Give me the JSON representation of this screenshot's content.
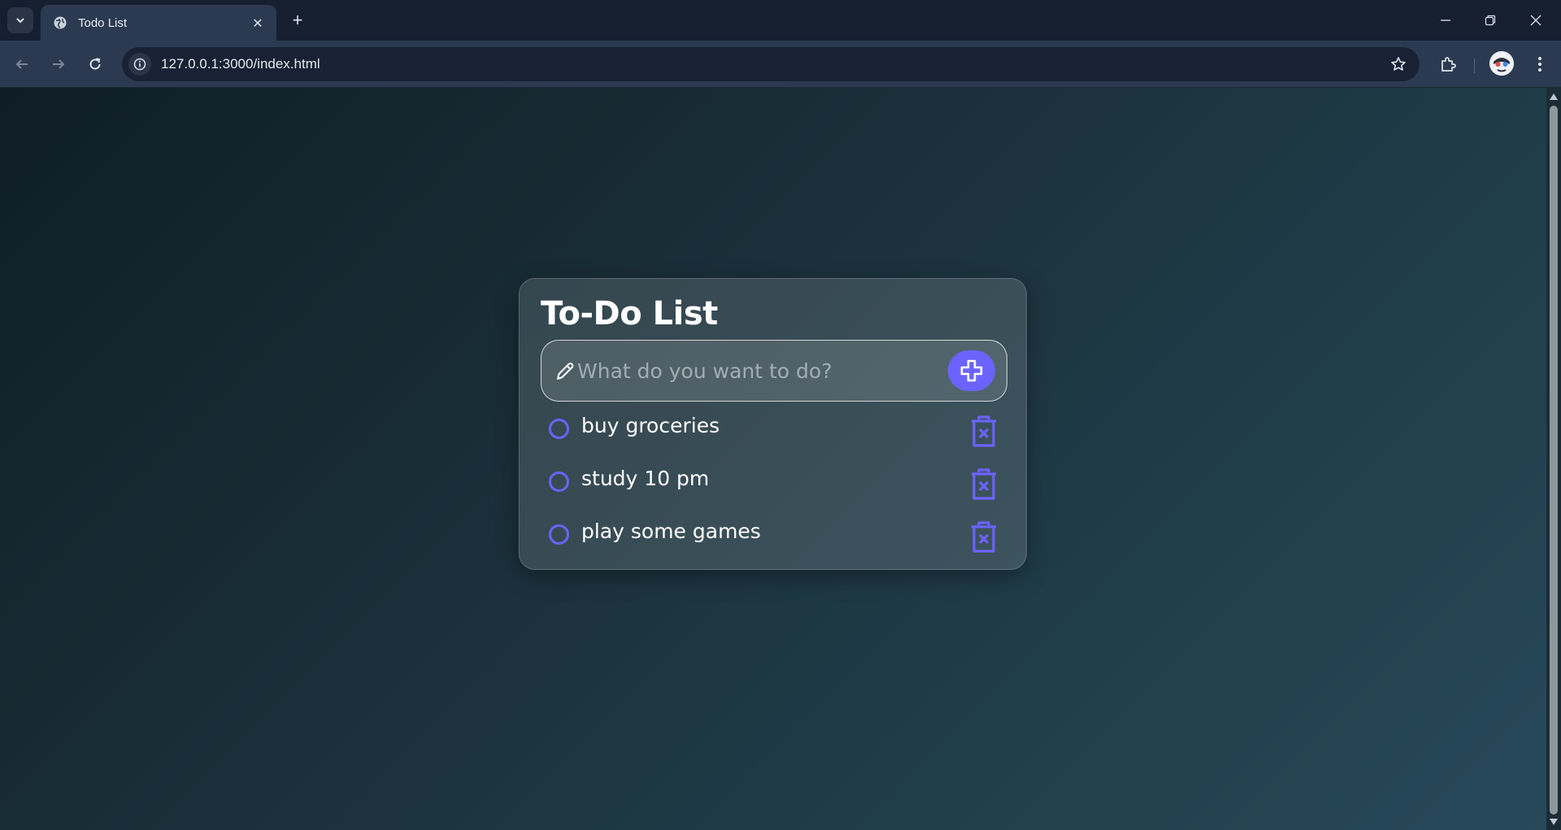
{
  "browser": {
    "tab_title": "Todo List",
    "tab_close_glyph": "✕",
    "new_tab_glyph": "+",
    "url": "127.0.0.1:3000/index.html",
    "icons": [
      "tab-search-icon",
      "globe-icon",
      "back-icon",
      "forward-icon",
      "reload-icon",
      "site-info-icon",
      "bookmark-star-icon",
      "extensions-icon",
      "profile-avatar",
      "menu-kebab-icon",
      "minimize-icon",
      "restore-icon",
      "close-icon"
    ]
  },
  "app": {
    "title": "To-Do List",
    "input_placeholder": "What do you want to do?",
    "input_value": "",
    "accent_color": "#6c63ff",
    "todos": [
      {
        "text": "buy groceries",
        "done": false
      },
      {
        "text": "study 10 pm",
        "done": false
      },
      {
        "text": "play some games",
        "done": false
      }
    ]
  }
}
